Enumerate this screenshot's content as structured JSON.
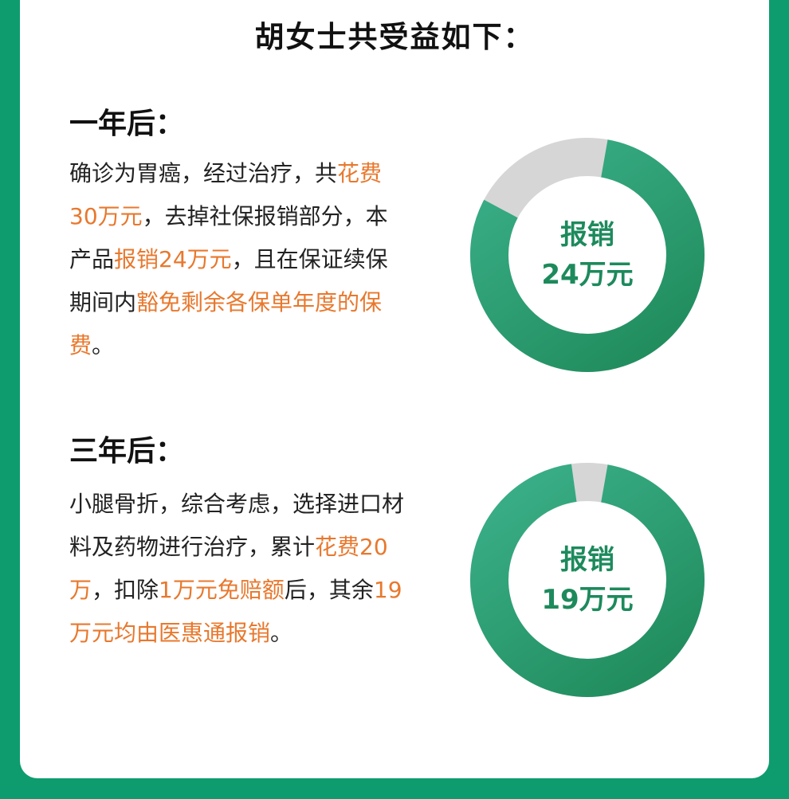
{
  "title": "胡女士共受益如下：",
  "sections": [
    {
      "heading": "一年后：",
      "paragraph": [
        {
          "text": "确诊为胃癌，经过治疗，共",
          "hl": false
        },
        {
          "text": "花费30万元",
          "hl": true
        },
        {
          "text": "，去掉社保报销部分，本产品",
          "hl": false
        },
        {
          "text": "报销24万元",
          "hl": true
        },
        {
          "text": "，且在保证续保期间内",
          "hl": false
        },
        {
          "text": "豁免剩余各保单年度的保费",
          "hl": true
        },
        {
          "text": "。",
          "hl": false
        }
      ],
      "ring": {
        "line1": "报销",
        "line2": "24万元",
        "fraction": 0.8
      }
    },
    {
      "heading": "三年后：",
      "paragraph": [
        {
          "text": "小腿骨折，综合考虑，选择进口材料及药物进行治疗，累计",
          "hl": false
        },
        {
          "text": "花费20万",
          "hl": true
        },
        {
          "text": "，扣除",
          "hl": false
        },
        {
          "text": "1万元免赔额",
          "hl": true
        },
        {
          "text": "后，其余",
          "hl": false
        },
        {
          "text": "19万元均由医惠通报销",
          "hl": true
        },
        {
          "text": "。",
          "hl": false
        }
      ],
      "ring": {
        "line1": "报销",
        "line2": "19万元",
        "fraction": 0.95
      }
    }
  ],
  "colors": {
    "background": "#0e9c6e",
    "highlight": "#e8782d",
    "ring_filled": "#1f8a5a",
    "ring_filled_light": "#3bb08a",
    "ring_empty": "#d6d6d6",
    "ring_text": "#1d8a5c"
  }
}
